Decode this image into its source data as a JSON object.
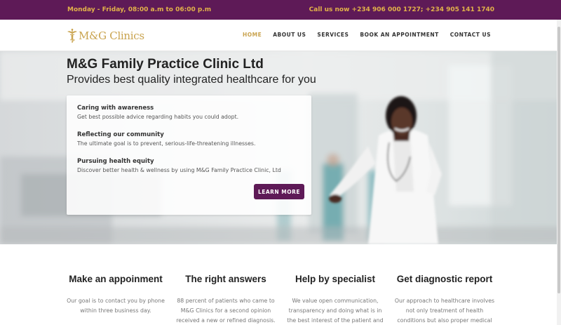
{
  "topbar": {
    "hours": "Monday - Friday, 08:00 a.m to 06:00 p.m",
    "phone": "Call us now +234 906 000 1727; +234 905 141 1740"
  },
  "header": {
    "logo_text": "M&G Clinics",
    "nav": [
      "HOME",
      "ABOUT US",
      "SERVICES",
      "BOOK AN APPOINTMENT",
      "CONTACT US"
    ],
    "active_nav": "HOME"
  },
  "hero": {
    "title": "M&G Family Practice Clinic Ltd",
    "subtitle": "Provides best quality integrated healthcare for you",
    "features": [
      {
        "title": "Caring with awareness",
        "text": "Get best possible advice regarding habits you could adopt."
      },
      {
        "title": "Reflecting our community",
        "text": "The ultimate goal is to prevent, serious-life-threatening illnesses."
      },
      {
        "title": "Pursuing health equity",
        "text": "Discover better health & wellness by using M&G Family Practice Clinic, Ltd"
      }
    ],
    "button_label": "LEARN MORE"
  },
  "columns": [
    {
      "title": "Make an appoinment",
      "lines": [
        "Our goal is to contact you by phone",
        "within three business day."
      ]
    },
    {
      "title": "The right answers",
      "lines": [
        "88 percent of patients who came to",
        "M&G Clinics for a second opinion",
        "received a new or refined diagnosis."
      ]
    },
    {
      "title": "Help by specialist",
      "lines": [
        "We value open communication,",
        "transparency and doing what is in",
        "the best interest of the patient and"
      ]
    },
    {
      "title": "Get diagnostic report",
      "lines": [
        "Our approach to healthcare involves",
        "not only treatment of health",
        "conditions but also proper medical"
      ]
    }
  ],
  "colors": {
    "brand": "#5e1a57",
    "accent": "#c9a34e"
  },
  "icons": {
    "logo": "caduceus-icon"
  }
}
